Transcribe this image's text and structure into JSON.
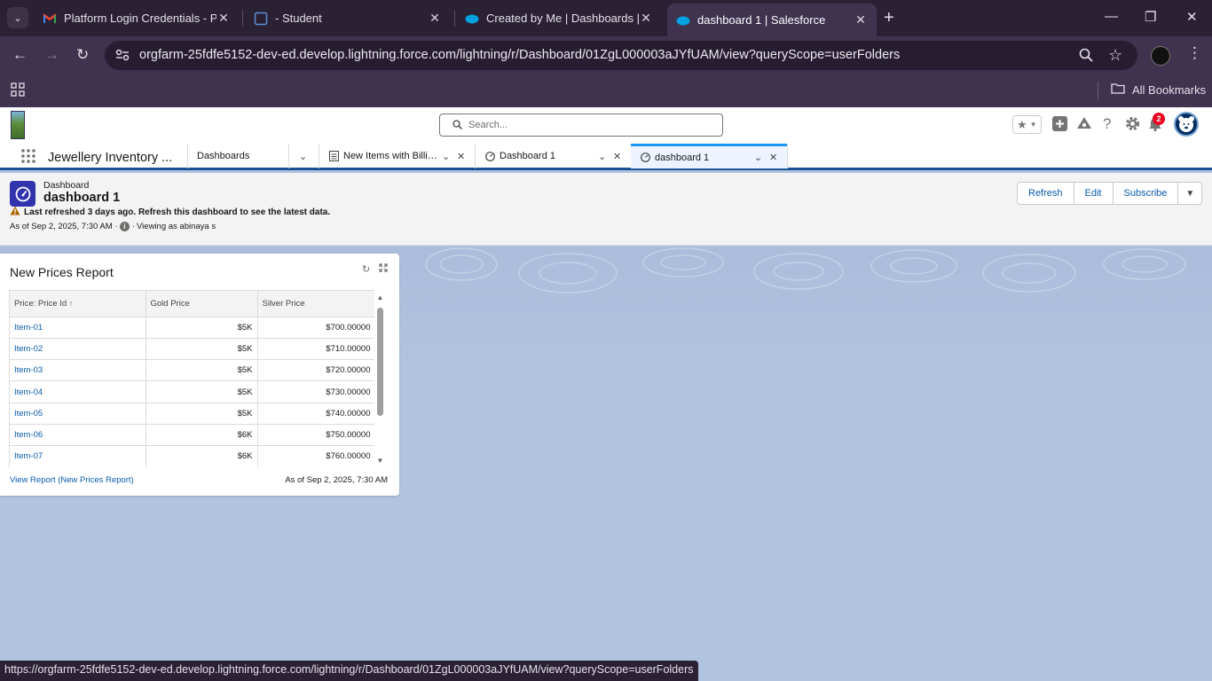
{
  "browser": {
    "tabs": [
      {
        "title": "Platform Login Credentials - Pre",
        "icon": "gmail-icon"
      },
      {
        "title": "- Student",
        "icon": "student-portal-icon"
      },
      {
        "title": "Created by Me | Dashboards | S",
        "icon": "salesforce-cloud-icon"
      },
      {
        "title": "dashboard 1 | Salesforce",
        "icon": "salesforce-cloud-icon",
        "active": true
      }
    ],
    "new_tab": "+",
    "url": "orgfarm-25fdfe5152-dev-ed.develop.lightning.force.com/lightning/r/Dashboard/01ZgL000003aJYfUAM/view?queryScope=userFolders",
    "all_bookmarks": "All Bookmarks",
    "status_url": "https://orgfarm-25fdfe5152-dev-ed.develop.lightning.force.com/lightning/r/Dashboard/01ZgL000003aJYfUAM/view?queryScope=userFolders"
  },
  "sf_header": {
    "search_placeholder": "Search...",
    "notification_count": "2"
  },
  "sf_nav": {
    "app_name": "Jewellery Inventory ...",
    "dashboards_label": "Dashboards",
    "workspace_tabs": [
      {
        "label": "New Items with Billin...",
        "icon": "report-icon"
      },
      {
        "label": "Dashboard 1",
        "icon": "dashboard-icon"
      },
      {
        "label": "dashboard 1",
        "icon": "dashboard-icon",
        "active": true
      }
    ]
  },
  "page_header": {
    "object_type": "Dashboard",
    "record_name": "dashboard 1",
    "warning": "Last refreshed 3 days ago. Refresh this dashboard to see the latest data.",
    "as_of": "As of Sep 2, 2025, 7:30 AM",
    "viewing_as": "Viewing as abinaya s",
    "buttons": {
      "refresh": "Refresh",
      "edit": "Edit",
      "subscribe": "Subscribe"
    }
  },
  "widget": {
    "title": "New Prices Report",
    "columns": [
      "Price: Price Id",
      "Gold Price",
      "Silver Price"
    ],
    "rows": [
      [
        "Item-01",
        "$5K",
        "$700.00000"
      ],
      [
        "Item-02",
        "$5K",
        "$710.00000"
      ],
      [
        "Item-03",
        "$5K",
        "$720.00000"
      ],
      [
        "Item-04",
        "$5K",
        "$730.00000"
      ],
      [
        "Item-05",
        "$5K",
        "$740.00000"
      ],
      [
        "Item-06",
        "$6K",
        "$750.00000"
      ],
      [
        "Item-07",
        "$6K",
        "$760.00000"
      ]
    ],
    "view_report": "View Report (New Prices Report)",
    "as_of": "As of Sep 2, 2025, 7:30 AM"
  },
  "colors": {
    "brand_blue": "#0b5cab",
    "nav_active_border": "#1b96ff",
    "dashboard_icon_bg": "#3033ac",
    "canvas_bg": "#b0c4df",
    "browser_frame": "#3f3350"
  }
}
